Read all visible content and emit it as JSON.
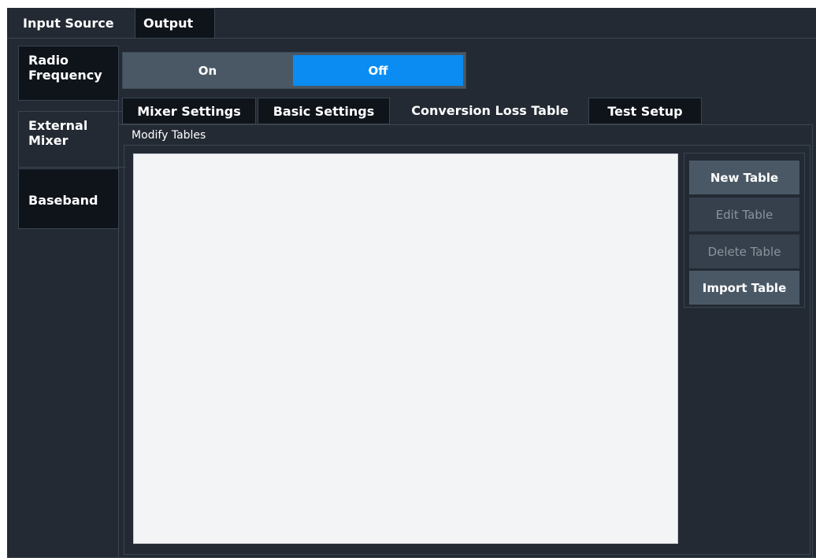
{
  "top_tabs": [
    {
      "label": "Input Source",
      "active": true
    },
    {
      "label": "Output",
      "active": false
    }
  ],
  "sidebar": {
    "items": [
      {
        "label_line1": "Radio",
        "label_line2": "Frequency",
        "active": false
      },
      {
        "label_line1": "External",
        "label_line2": "Mixer",
        "active": true
      },
      {
        "label_line1": "Baseband",
        "label_line2": "",
        "active": false
      }
    ]
  },
  "toggle": {
    "on_label": "On",
    "off_label": "Off",
    "selected": "Off"
  },
  "sub_tabs": [
    {
      "label": "Mixer Settings",
      "active": false
    },
    {
      "label": "Basic Settings",
      "active": false
    },
    {
      "label": "Conversion Loss Table",
      "active": true
    },
    {
      "label": "Test Setup",
      "active": false
    }
  ],
  "group": {
    "title": "Modify Tables"
  },
  "buttons": {
    "new_table": "New Table",
    "edit_table": "Edit Table",
    "delete_table": "Delete Table",
    "import_table": "Import Table"
  },
  "colors": {
    "background": "#232a33",
    "accent": "#0a8cf2",
    "button": "#4a5866"
  }
}
